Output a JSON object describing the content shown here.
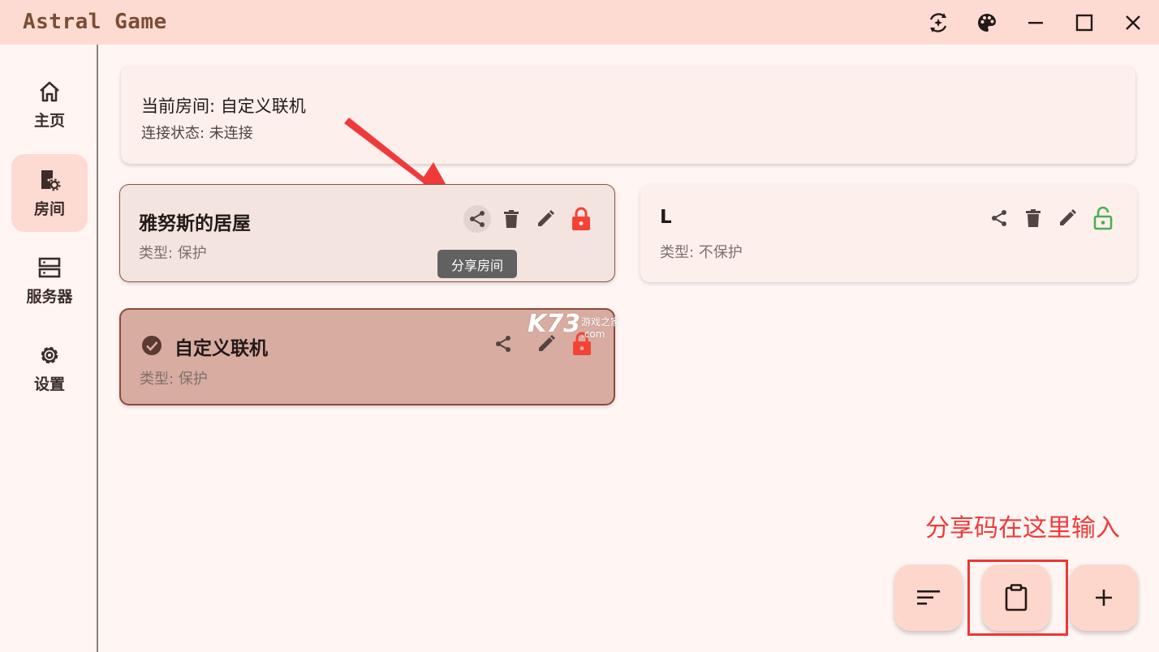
{
  "window": {
    "title": "Astral Game",
    "controls": [
      "swap-icon",
      "palette-icon",
      "minimize-icon",
      "maximize-icon",
      "close-icon"
    ]
  },
  "sidebar": {
    "items": [
      {
        "label": "主页",
        "icon": "home-icon",
        "active": false
      },
      {
        "label": "房间",
        "icon": "room-settings-icon",
        "active": true
      },
      {
        "label": "服务器",
        "icon": "server-icon",
        "active": false
      },
      {
        "label": "设置",
        "icon": "gear-icon",
        "active": false
      }
    ]
  },
  "current_room": {
    "title": "当前房间: 自定义联机",
    "status": "连接状态: 未连接"
  },
  "rooms": [
    {
      "name": "雅努斯的居屋",
      "type": "类型: 保护",
      "locked": true,
      "selected": false,
      "hovered": true
    },
    {
      "name": "L",
      "type": "类型: 不保护",
      "locked": false,
      "selected": false
    },
    {
      "name": "自定义联机",
      "type": "类型: 保护",
      "locked": true,
      "selected": true
    }
  ],
  "tooltip": {
    "text": "分享房间"
  },
  "watermark": {
    "main": "K73",
    "sub": "游戏之家",
    "domain": ".com"
  },
  "annotation": {
    "text": "分享码在这里输入"
  },
  "fabs": [
    {
      "icon": "sort-icon"
    },
    {
      "icon": "clipboard-icon"
    },
    {
      "icon": "add-icon"
    }
  ],
  "colors": {
    "titlebar": "#fddbd2",
    "accent": "#7a4e35",
    "lock_red": "#f44336",
    "lock_green": "#4caf50",
    "selected_card": "#d8aca1",
    "annotation_red": "#f03a3a"
  }
}
